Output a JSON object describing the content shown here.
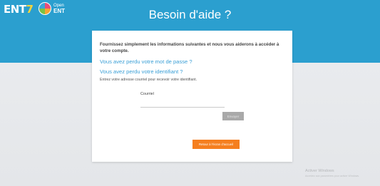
{
  "header": {
    "logo_text": "ENT",
    "logo_seven": "7",
    "logo_open_line1": "Open",
    "logo_open_line2": "ENT",
    "title": "Besoin d'aide ?",
    "background_color": "#2b9fcf"
  },
  "form": {
    "intro": "Fournissez simplement les informations suivantes et nous vous aiderons à accéder à votre compte.",
    "forgot_password_link": "Vous avez perdu votre mot de passe ?",
    "forgot_id_link": "Vous avez perdu votre identifiant ?",
    "hint": "Entrez votre adresse courriel pour recevoir votre identifiant.",
    "email_label": "Courriel",
    "email_value": "",
    "send_button": "Envoyer",
    "back_button": "Retour à l'écran d'accueil",
    "link_color": "#3a9fd6",
    "back_button_color": "#f57f1f"
  },
  "watermark": {
    "title": "Activer Windows",
    "subtitle": "Accédez aux paramètres pour activer Windows."
  }
}
